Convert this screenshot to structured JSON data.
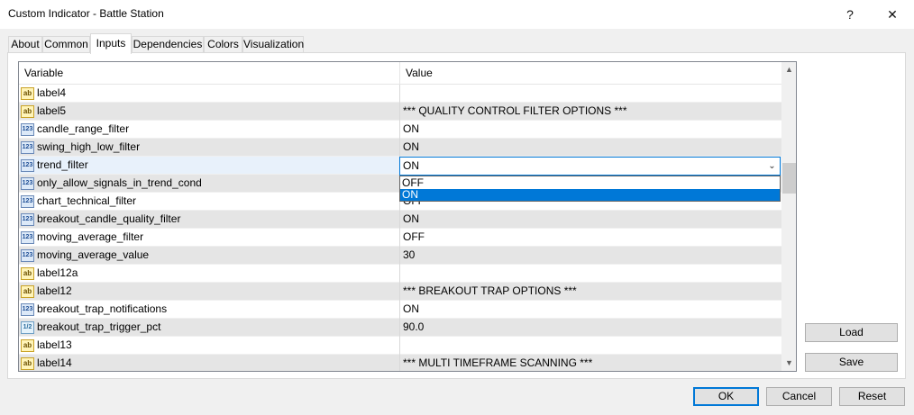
{
  "window": {
    "title": "Custom Indicator - Battle Station",
    "help_glyph": "?",
    "close_glyph": "✕"
  },
  "tabs": [
    {
      "label": "About"
    },
    {
      "label": "Common"
    },
    {
      "label": "Inputs"
    },
    {
      "label": "Dependencies"
    },
    {
      "label": "Colors"
    },
    {
      "label": "Visualization"
    }
  ],
  "active_tab": "Inputs",
  "grid": {
    "headers": {
      "variable": "Variable",
      "value": "Value"
    },
    "rows": [
      {
        "icon": "ab",
        "icon_name": "string-type-icon",
        "variable": "label4",
        "value": ""
      },
      {
        "icon": "ab",
        "icon_name": "string-type-icon",
        "variable": "label5",
        "value": "*** QUALITY CONTROL FILTER OPTIONS ***"
      },
      {
        "icon": "123",
        "icon_name": "integer-type-icon",
        "variable": "candle_range_filter",
        "value": "ON"
      },
      {
        "icon": "123",
        "icon_name": "integer-type-icon",
        "variable": "swing_high_low_filter",
        "value": "ON"
      },
      {
        "icon": "123",
        "icon_name": "integer-type-icon",
        "variable": "trend_filter",
        "value": "ON"
      },
      {
        "icon": "123",
        "icon_name": "integer-type-icon",
        "variable": "only_allow_signals_in_trend_cond",
        "value": ""
      },
      {
        "icon": "123",
        "icon_name": "integer-type-icon",
        "variable": "chart_technical_filter",
        "value": "OFF"
      },
      {
        "icon": "123",
        "icon_name": "integer-type-icon",
        "variable": "breakout_candle_quality_filter",
        "value": "ON"
      },
      {
        "icon": "123",
        "icon_name": "integer-type-icon",
        "variable": "moving_average_filter",
        "value": "OFF"
      },
      {
        "icon": "123",
        "icon_name": "integer-type-icon",
        "variable": "moving_average_value",
        "value": "30"
      },
      {
        "icon": "ab",
        "icon_name": "string-type-icon",
        "variable": "label12a",
        "value": ""
      },
      {
        "icon": "ab",
        "icon_name": "string-type-icon",
        "variable": "label12",
        "value": "*** BREAKOUT TRAP OPTIONS ***"
      },
      {
        "icon": "123",
        "icon_name": "integer-type-icon",
        "variable": "breakout_trap_notifications",
        "value": "ON"
      },
      {
        "icon": "1/2",
        "icon_name": "double-type-icon",
        "variable": "breakout_trap_trigger_pct",
        "value": "90.0"
      },
      {
        "icon": "ab",
        "icon_name": "string-type-icon",
        "variable": "label13",
        "value": ""
      },
      {
        "icon": "ab",
        "icon_name": "string-type-icon",
        "variable": "label14",
        "value": "*** MULTI TIMEFRAME SCANNING ***"
      }
    ],
    "selected_row_index": 4
  },
  "combo": {
    "value": "ON",
    "options": [
      "OFF",
      "ON"
    ],
    "highlighted": "ON"
  },
  "side_buttons": {
    "load": "Load",
    "save": "Save"
  },
  "footer_buttons": {
    "ok": "OK",
    "cancel": "Cancel",
    "reset": "Reset"
  },
  "colors": {
    "selection": "#0078d7",
    "row_alt": "#e5e5e5",
    "icon_string": "#fff4b8",
    "icon_number": "#dce9f8"
  },
  "scrollbar": {
    "up_glyph": "▲",
    "down_glyph": "▼"
  }
}
